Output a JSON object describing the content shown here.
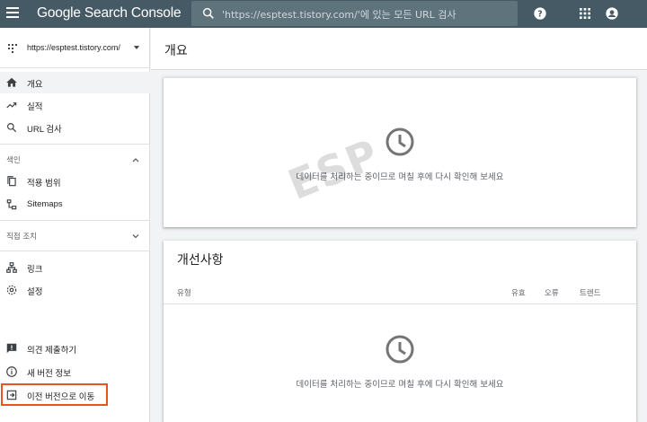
{
  "topbar": {
    "logo": "Google Search Console",
    "search_placeholder": "'https://esptest.tistory.com/'에 있는 모든 URL 검사",
    "icons": [
      "menu-icon",
      "search-icon",
      "help-icon",
      "apps-icon",
      "account-icon"
    ]
  },
  "sidebar": {
    "property": "https://esptest.tistory.com/",
    "nav": [
      {
        "label": "개요",
        "icon": "home-icon",
        "active": true
      },
      {
        "label": "실적",
        "icon": "trending-up-icon"
      },
      {
        "label": "URL 검사",
        "icon": "search-icon"
      }
    ],
    "index_section": {
      "label": "색인",
      "items": [
        {
          "label": "적용 범위",
          "icon": "copy-icon"
        },
        {
          "label": "Sitemaps",
          "icon": "sitemap-icon"
        }
      ]
    },
    "manual_section": {
      "label": "직접 조치"
    },
    "other_items": [
      {
        "label": "링크",
        "icon": "links-icon"
      },
      {
        "label": "설정",
        "icon": "gear-icon"
      }
    ],
    "bottom_items": [
      {
        "label": "의견 제출하기",
        "icon": "feedback-icon"
      },
      {
        "label": "새 버전 정보",
        "icon": "info-icon"
      },
      {
        "label": "이전 버전으로 이동",
        "icon": "exit-icon"
      }
    ],
    "highlight_color": "#e8531f"
  },
  "main": {
    "title": "개요",
    "performance_card": {
      "empty_message": "데이터를 처리하는 중이므로 며칠 후에 다시 확인해 보세요"
    },
    "enhancements_card": {
      "title": "개선사항",
      "columns": [
        "유형",
        "유효",
        "오류",
        "트렌드"
      ],
      "empty_message": "데이터를 처리하는 중이므로 며칠 후에 다시 확인해 보세요"
    }
  },
  "watermark": "ESP"
}
